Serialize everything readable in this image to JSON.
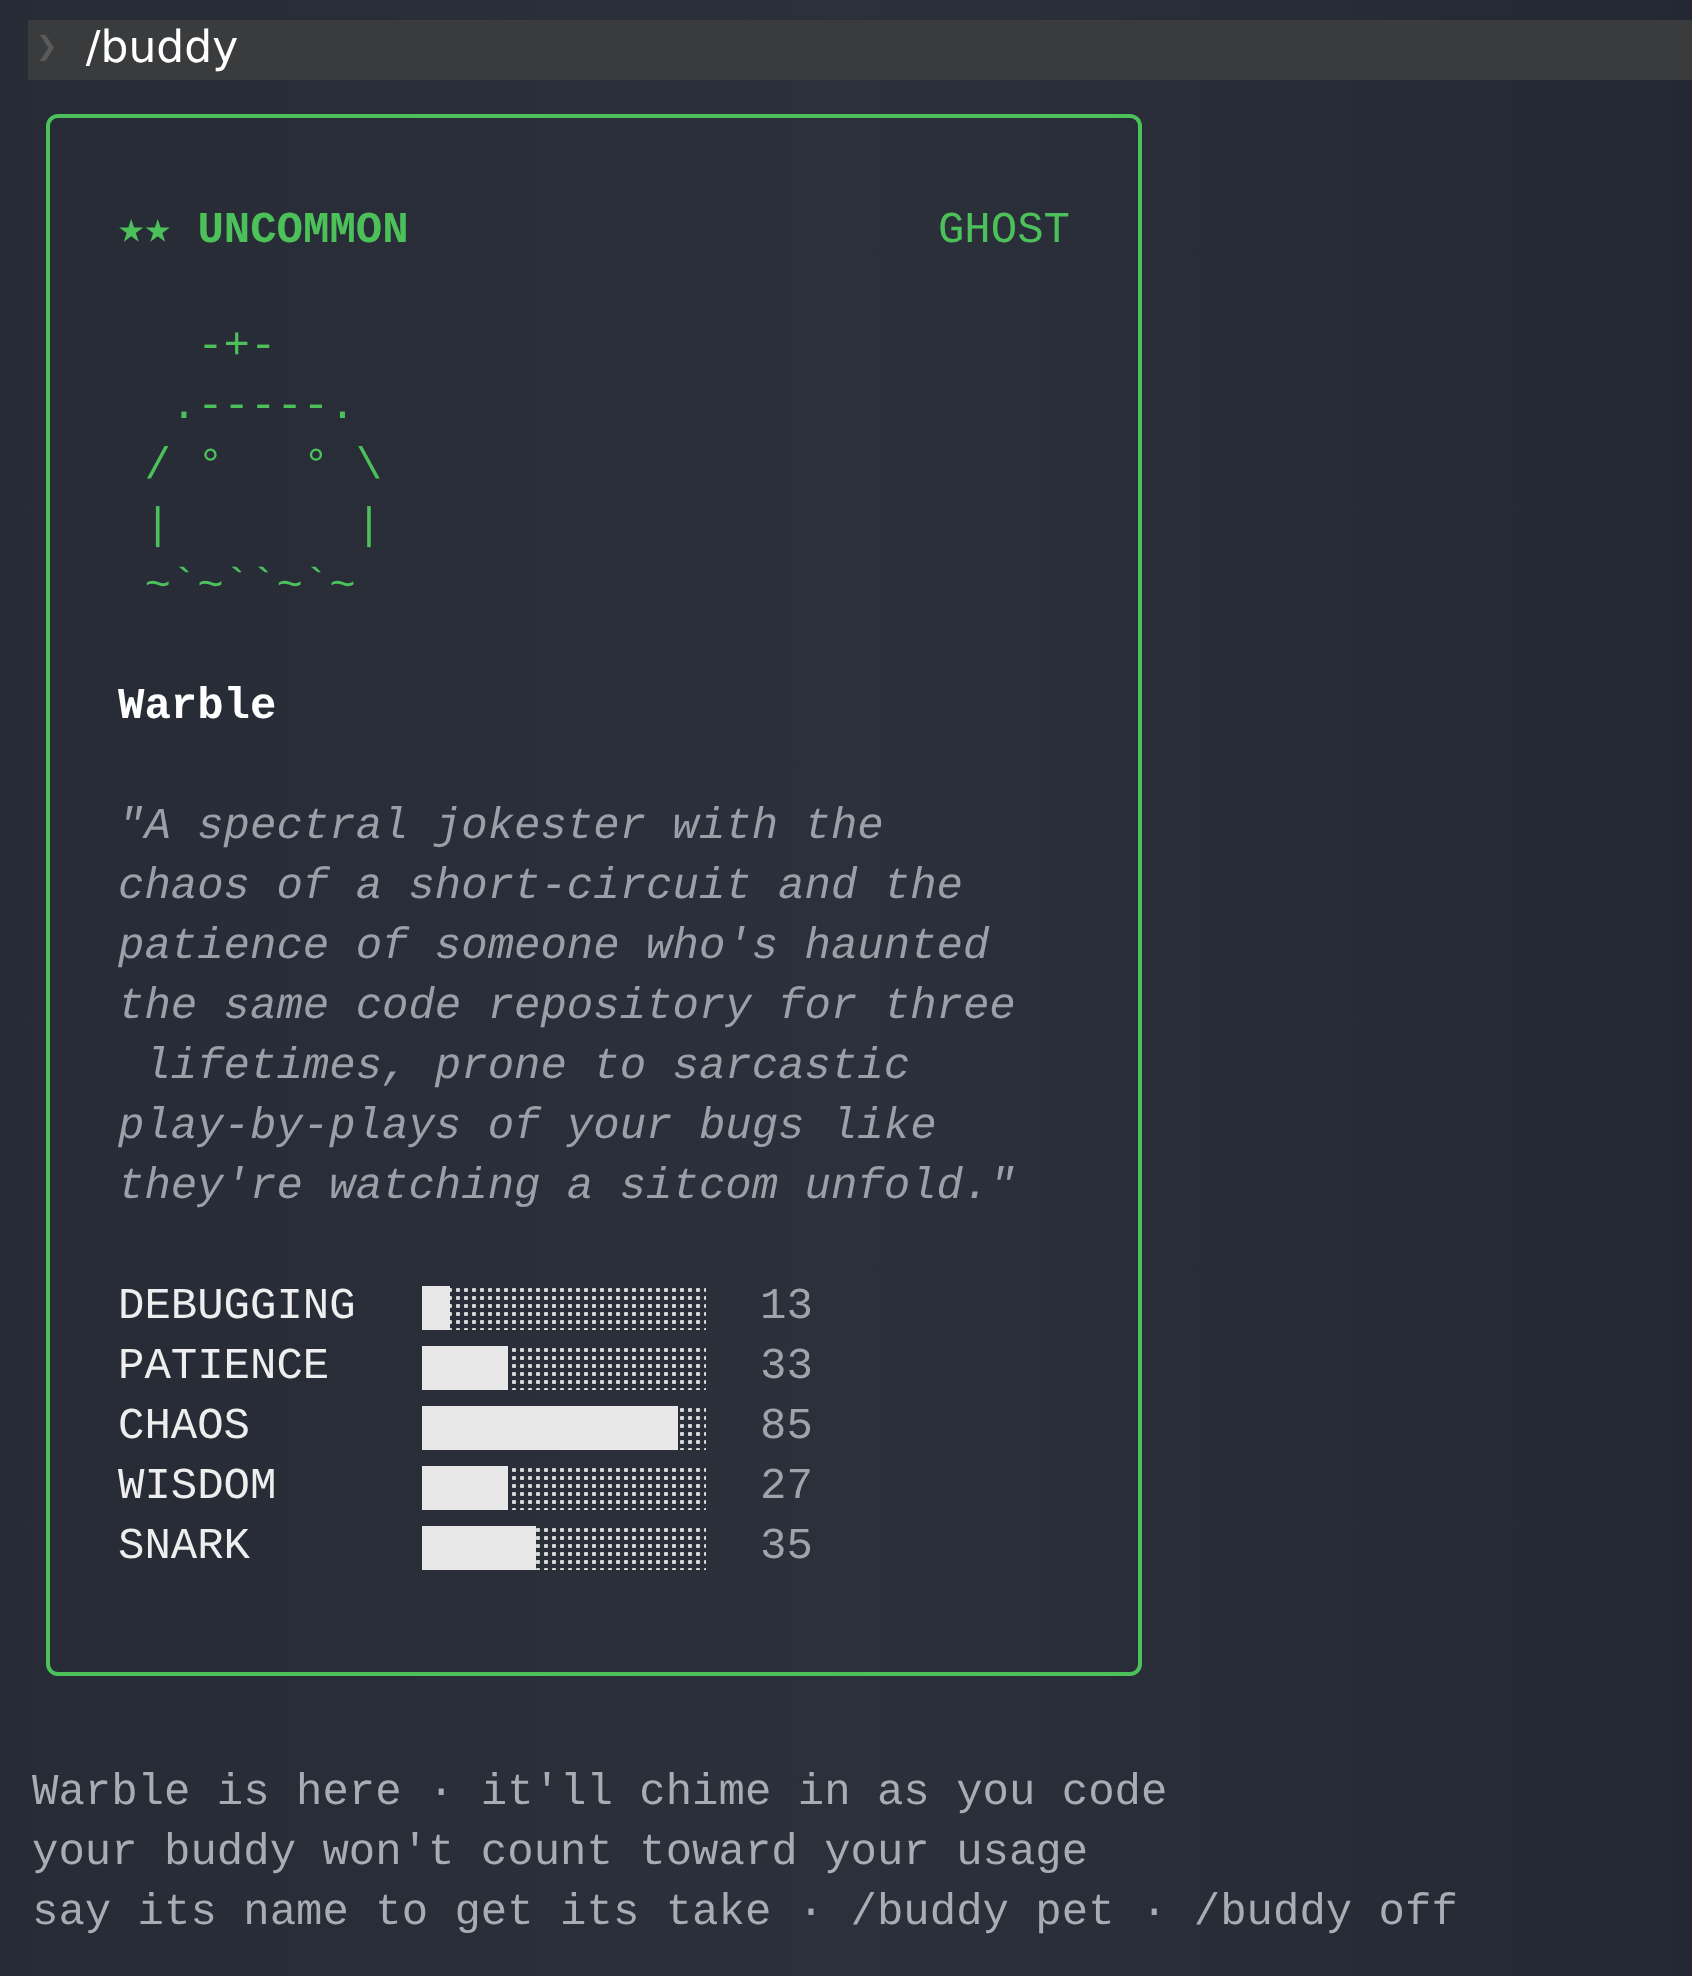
{
  "prompt": {
    "symbol": "❯",
    "command": "/buddy"
  },
  "card": {
    "rarity": "★★ UNCOMMON",
    "species": "GHOST",
    "art": [
      "   -+-",
      "  .-----.",
      " / °   ° \\",
      " |       |",
      " ~`~``~`~"
    ],
    "name": "Warble",
    "quote": "\"A spectral jokester with the\nchaos of a short-circuit and the\npatience of someone who's haunted\nthe same code repository for three\n lifetimes, prone to sarcastic\nplay-by-plays of your bugs like\nthey're watching a sitcom unfold.\"",
    "stats": [
      {
        "label": "DEBUGGING",
        "level": 0.1,
        "value": "13"
      },
      {
        "label": "PATIENCE",
        "level": 0.3,
        "value": "33"
      },
      {
        "label": "CHAOS",
        "level": 0.9,
        "value": "85"
      },
      {
        "label": "WISDOM",
        "level": 0.3,
        "value": "27"
      },
      {
        "label": "SNARK",
        "level": 0.4,
        "value": "35"
      }
    ]
  },
  "messages": [
    "Warble is here · it'll chime in as you code",
    "your buddy won't count toward your usage",
    "say its name to get its take · /buddy pet · /buddy off"
  ]
}
